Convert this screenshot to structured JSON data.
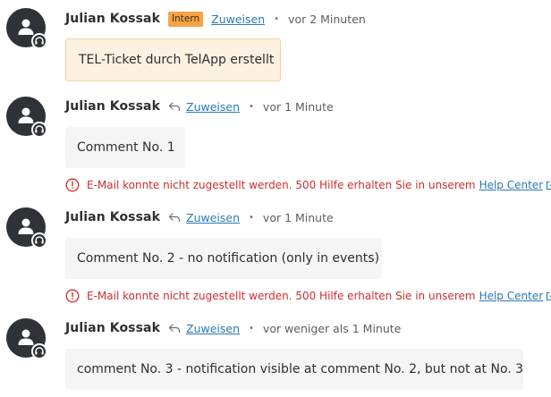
{
  "entries": [
    {
      "author": "Julian Kossak",
      "badge": "Intern",
      "assign_label": "Zuweisen",
      "separator": "•",
      "time": "vor 2 Minuten",
      "body": "TEL-Ticket durch TelApp erstellt"
    },
    {
      "author": "Julian Kossak",
      "assign_label": "Zuweisen",
      "separator": "•",
      "time": "vor 1 Minute",
      "body": "Comment No. 1",
      "error": "E-Mail konnte nicht zugestellt werden. 500 Hilfe erhalten Sie in unserem",
      "help_link": "Help Center"
    },
    {
      "author": "Julian Kossak",
      "assign_label": "Zuweisen",
      "separator": "•",
      "time": "vor 1 Minute",
      "body": "Comment No. 2 - no notification (only in events)",
      "error": "E-Mail konnte nicht zugestellt werden. 500 Hilfe erhalten Sie in unserem",
      "help_link": "Help Center"
    },
    {
      "author": "Julian Kossak",
      "assign_label": "Zuweisen",
      "separator": "•",
      "time": "vor weniger als 1 Minute",
      "body": "comment No. 3 - notification visible at comment No. 2, but not at No. 3"
    }
  ],
  "icons": {
    "avatar": "person-icon",
    "agent": "headset-icon",
    "reply": "reply-icon",
    "error": "error-circle-icon",
    "external": "external-link-icon"
  },
  "colors": {
    "avatar_bg": "#2f3237",
    "intern_badge": "#f6a447",
    "internal_bubble_bg": "#fdf1e1",
    "bubble_bg": "#f5f5f5",
    "link": "#2a7ab3",
    "error": "#cf2e2e"
  }
}
